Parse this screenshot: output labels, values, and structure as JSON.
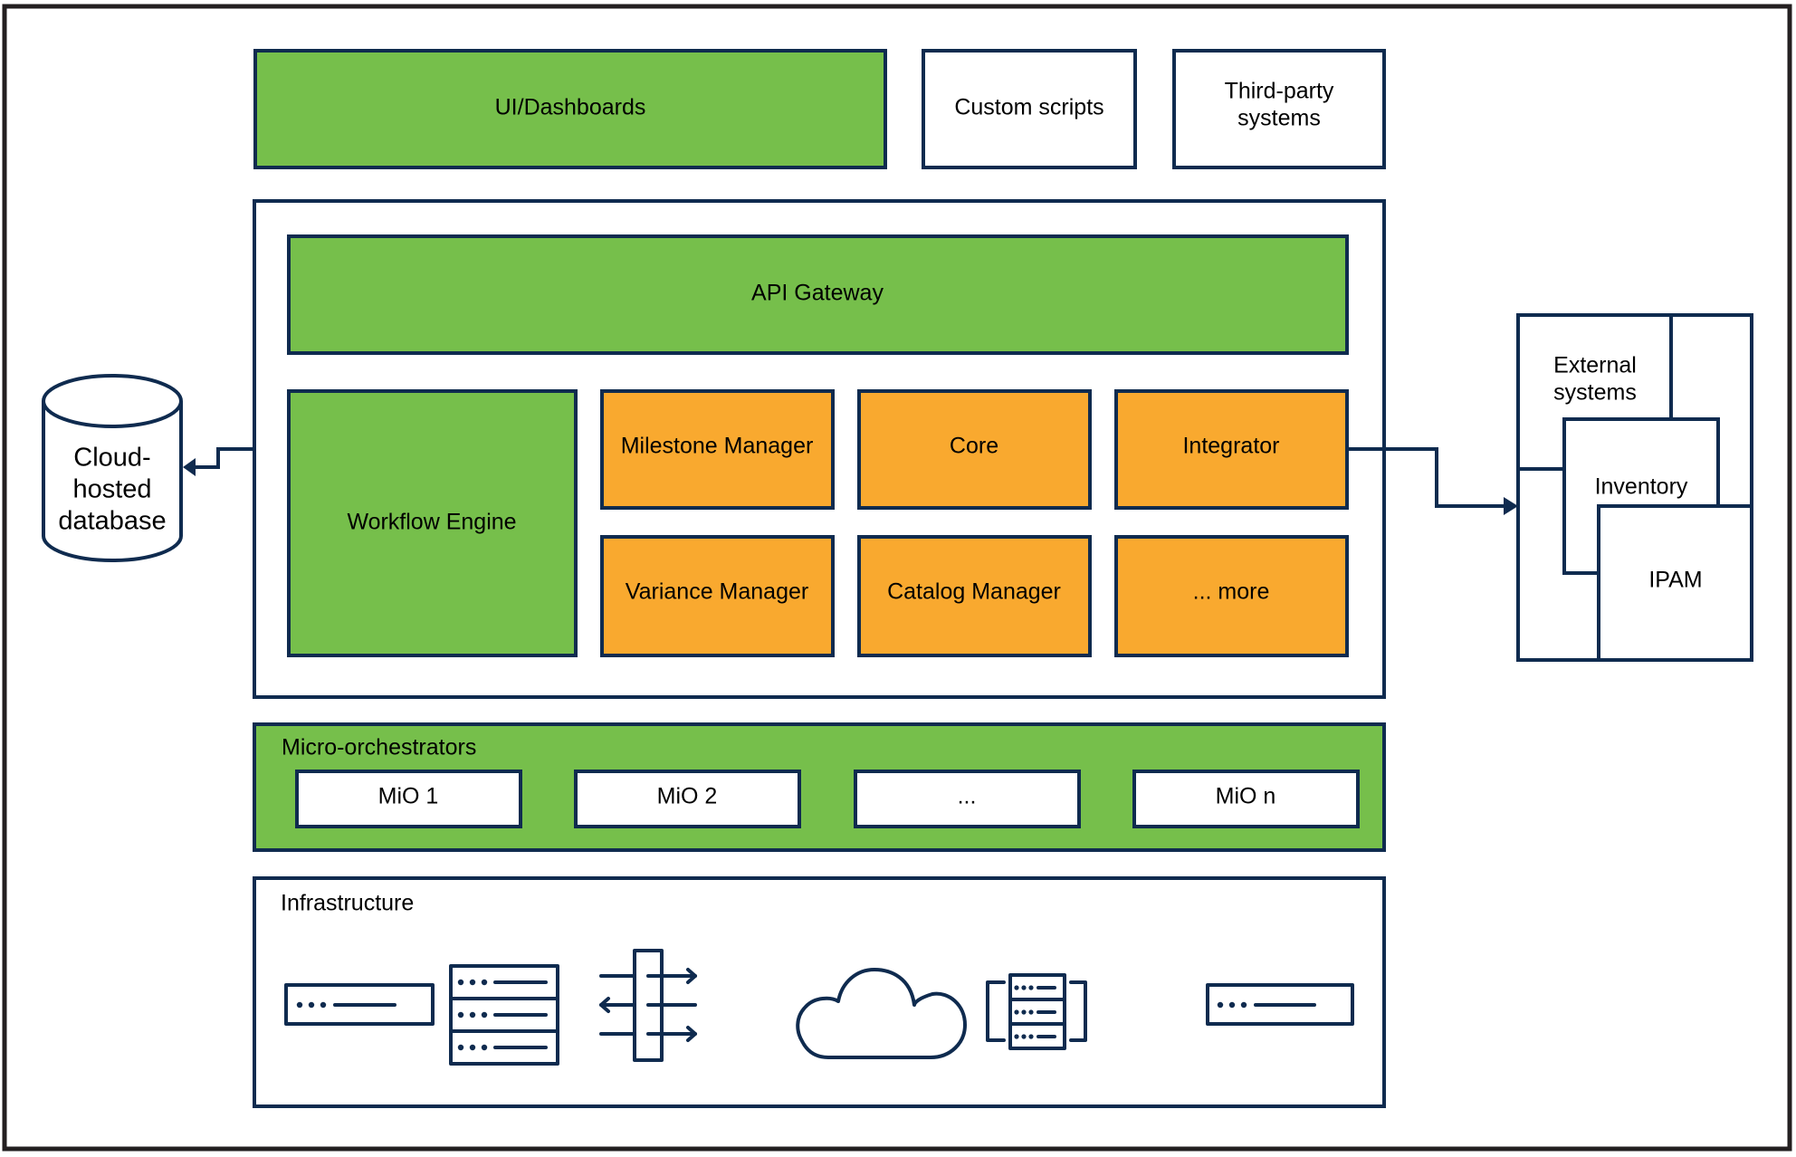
{
  "colors": {
    "green": "#76BF4B",
    "orange": "#F9A92F",
    "outline": "#0F2B4F",
    "frame": "#231F20"
  },
  "top_row": {
    "ui_dashboards": "UI/Dashboards",
    "custom_scripts": "Custom scripts",
    "third_party": [
      "Third-party",
      "systems"
    ]
  },
  "platform": {
    "api_gateway": "API Gateway",
    "workflow_engine": "Workflow Engine",
    "modules": [
      "Milestone Manager",
      "Core",
      "Integrator",
      "Variance Manager",
      "Catalog Manager",
      "... more"
    ]
  },
  "database": {
    "label": [
      "Cloud-",
      "hosted",
      "database"
    ],
    "icon": "database-cylinder-icon"
  },
  "external": {
    "label": [
      "External",
      "systems"
    ],
    "inventory": "Inventory",
    "ipam": "IPAM"
  },
  "micro_orchestrators": {
    "title": "Micro-orchestrators",
    "items": [
      "MiO 1",
      "MiO 2",
      "...",
      "MiO n"
    ]
  },
  "infrastructure": {
    "title": "Infrastructure",
    "icons": [
      "network-device-icon",
      "server-rack-icon",
      "load-balancer-icon",
      "cloud-icon",
      "virtual-server-icon",
      "network-device-icon"
    ]
  }
}
